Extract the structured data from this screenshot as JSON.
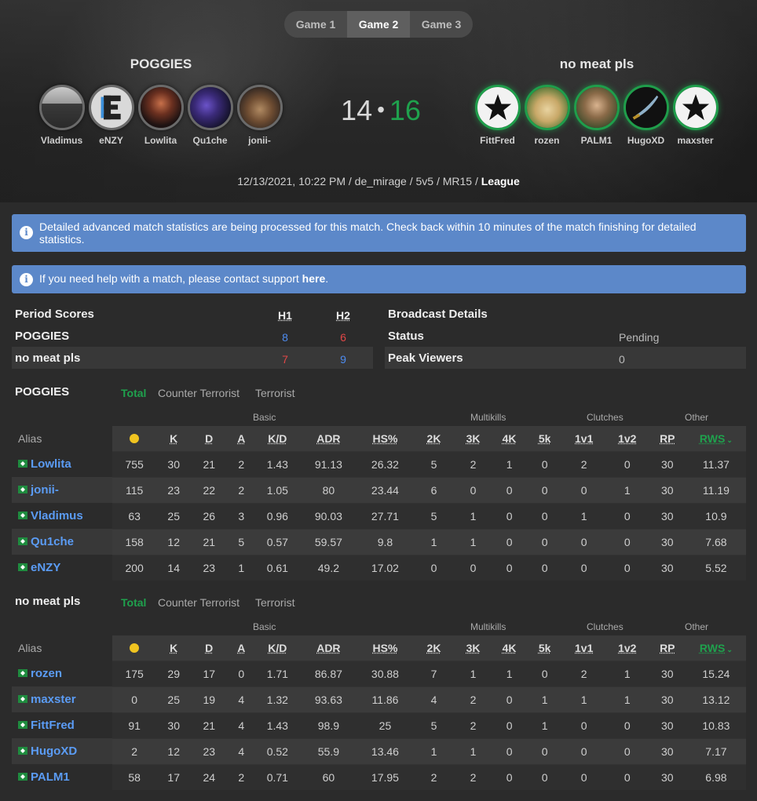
{
  "game_tabs": [
    "Game 1",
    "Game 2",
    "Game 3"
  ],
  "active_game_tab": 1,
  "team_left": {
    "name": "POGGIES",
    "players": [
      "Vladimus",
      "eNZY",
      "Lowlita",
      "Qu1che",
      "jonii-"
    ]
  },
  "team_right": {
    "name": "no meat pls",
    "players": [
      "FittFred",
      "rozen",
      "PALM1",
      "HugoXD",
      "maxster"
    ]
  },
  "score": {
    "left": "14",
    "separator": "•",
    "right": "16"
  },
  "match_meta": {
    "text": "12/13/2021, 10:22 PM / de_mirage / 5v5 / MR15 / ",
    "type": "League"
  },
  "alerts": {
    "processing": "Detailed advanced match statistics are being processed for this match. Check back within 10 minutes of the match finishing for detailed statistics.",
    "help_text": "If you need help with a match, please contact support ",
    "help_link": "here",
    "help_end": "."
  },
  "period_scores": {
    "title": "Period Scores",
    "h1": "H1",
    "h2": "H2",
    "rows": [
      {
        "team": "POGGIES",
        "h1": "8",
        "h2": "6"
      },
      {
        "team": "no meat pls",
        "h1": "7",
        "h2": "9"
      }
    ]
  },
  "broadcast": {
    "title": "Broadcast Details",
    "rows": [
      {
        "label": "Status",
        "value": "Pending"
      },
      {
        "label": "Peak Viewers",
        "value": "0"
      }
    ]
  },
  "side_tabs": [
    "Total",
    "Counter Terrorist",
    "Terrorist"
  ],
  "column_groups": [
    "Basic",
    "Multikills",
    "Clutches",
    "Other"
  ],
  "columns": [
    "Alias",
    "K",
    "D",
    "A",
    "K/D",
    "ADR",
    "HS%",
    "2K",
    "3K",
    "4K",
    "5k",
    "1v1",
    "1v2",
    "RP",
    "RWS"
  ],
  "tables": [
    {
      "team": "POGGIES",
      "rows": [
        [
          "Lowlita",
          "755",
          "30",
          "21",
          "2",
          "1.43",
          "91.13",
          "26.32",
          "5",
          "2",
          "1",
          "0",
          "2",
          "0",
          "30",
          "11.37"
        ],
        [
          "jonii-",
          "115",
          "23",
          "22",
          "2",
          "1.05",
          "80",
          "23.44",
          "6",
          "0",
          "0",
          "0",
          "0",
          "1",
          "30",
          "11.19"
        ],
        [
          "Vladimus",
          "63",
          "25",
          "26",
          "3",
          "0.96",
          "90.03",
          "27.71",
          "5",
          "1",
          "0",
          "0",
          "1",
          "0",
          "30",
          "10.9"
        ],
        [
          "Qu1che",
          "158",
          "12",
          "21",
          "5",
          "0.57",
          "59.57",
          "9.8",
          "1",
          "1",
          "0",
          "0",
          "0",
          "0",
          "30",
          "7.68"
        ],
        [
          "eNZY",
          "200",
          "14",
          "23",
          "1",
          "0.61",
          "49.2",
          "17.02",
          "0",
          "0",
          "0",
          "0",
          "0",
          "0",
          "30",
          "5.52"
        ]
      ]
    },
    {
      "team": "no meat pls",
      "rows": [
        [
          "rozen",
          "175",
          "29",
          "17",
          "0",
          "1.71",
          "86.87",
          "30.88",
          "7",
          "1",
          "1",
          "0",
          "2",
          "1",
          "30",
          "15.24"
        ],
        [
          "maxster",
          "0",
          "25",
          "19",
          "4",
          "1.32",
          "93.63",
          "11.86",
          "4",
          "2",
          "0",
          "1",
          "1",
          "1",
          "30",
          "13.12"
        ],
        [
          "FittFred",
          "91",
          "30",
          "21",
          "4",
          "1.43",
          "98.9",
          "25",
          "5",
          "2",
          "0",
          "1",
          "0",
          "0",
          "30",
          "10.83"
        ],
        [
          "HugoXD",
          "2",
          "12",
          "23",
          "4",
          "0.52",
          "55.9",
          "13.46",
          "1",
          "1",
          "0",
          "0",
          "0",
          "0",
          "30",
          "7.17"
        ],
        [
          "PALM1",
          "58",
          "17",
          "24",
          "2",
          "0.71",
          "60",
          "17.95",
          "2",
          "2",
          "0",
          "0",
          "0",
          "0",
          "30",
          "6.98"
        ]
      ]
    }
  ],
  "colors": {
    "accent_green": "#1fa14d",
    "link_blue": "#5b9cf5",
    "alert_blue": "#5c88c9",
    "score_red": "#e24747",
    "score_blue": "#4e8cf0"
  }
}
